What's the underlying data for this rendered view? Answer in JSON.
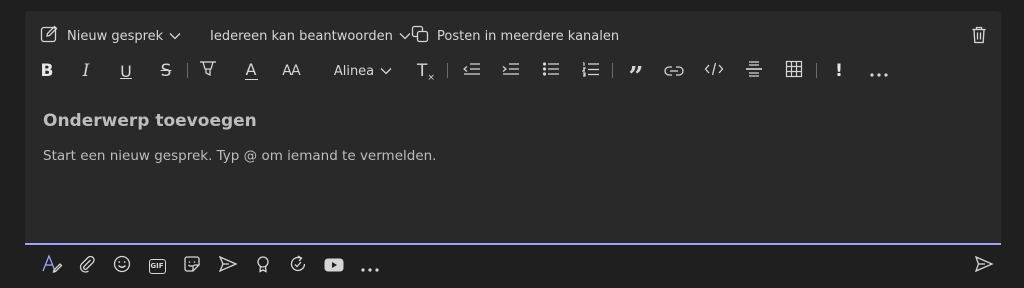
{
  "header": {
    "new_conversation_label": "Nieuw gesprek",
    "reply_setting_label": "Iedereen kan beantwoorden",
    "post_multiple_label": "Posten in meerdere kanalen"
  },
  "formatting": {
    "bold": "B",
    "italic": "I",
    "underline": "U",
    "strikethrough": "S",
    "font_color": "A",
    "font_size": "AA",
    "paragraph_label": "Alinea",
    "clear_format": "T"
  },
  "editor": {
    "subject_placeholder": "Onderwerp toevoegen",
    "body_placeholder": "Start een nieuw gesprek. Typ @ om iemand te vermelden."
  },
  "icons": {
    "gif_label": "GIF",
    "important": "!"
  },
  "colors": {
    "accent": "#9ea2ff",
    "background": "#1f1f1f",
    "panel": "#292929",
    "text": "#d6d6d6"
  }
}
